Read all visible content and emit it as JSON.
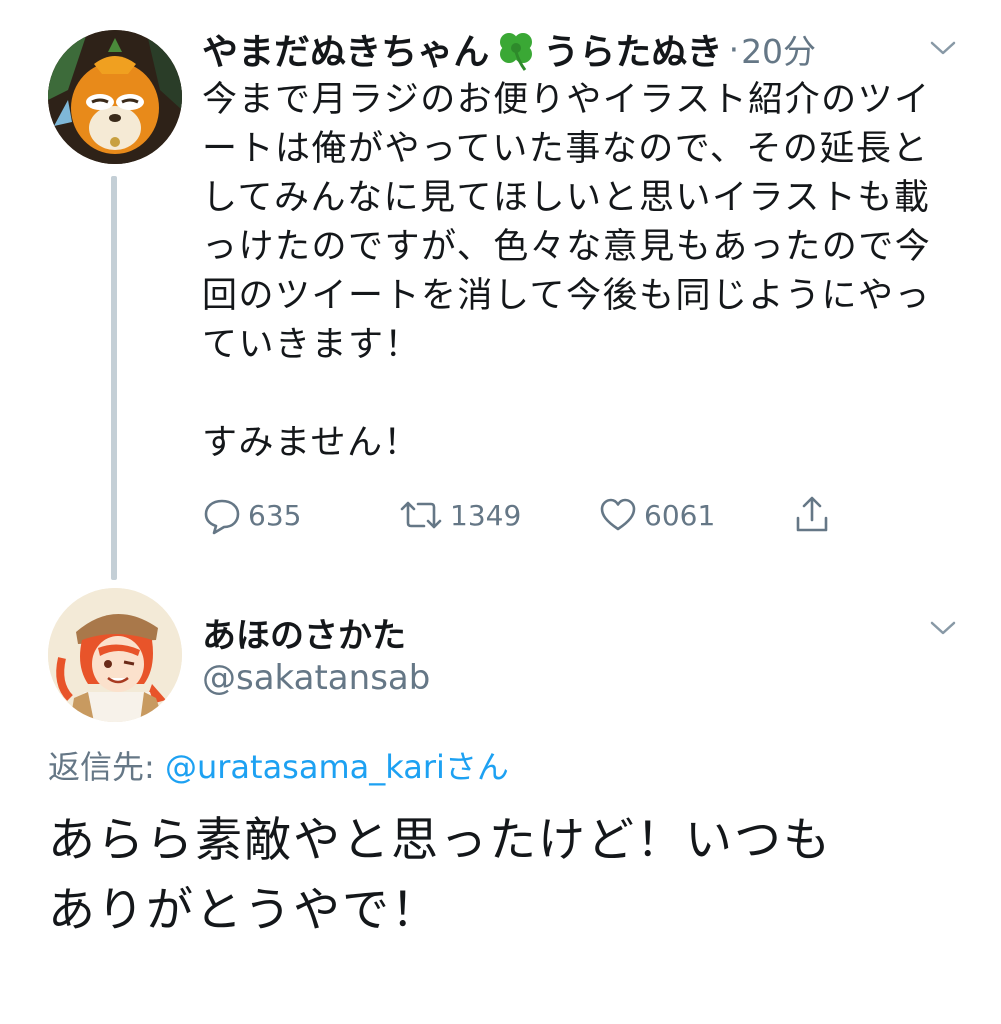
{
  "tweet1": {
    "display_name_part1": "やまだぬきちゃん",
    "display_name_part2": "うらたぬき",
    "time_separator": "·",
    "time": "20分",
    "text_lines": [
      "今まで月ラジのお便りやイラスト紹介のツイ",
      "ートは俺がやっていた事なので、その延長と",
      "してみんなに見てほしいと思いイラストも載",
      "っけたのですが、色々な意見もあったので今",
      "回のツイートを消して今後も同じようにやっ",
      "ていきます！",
      "",
      "すみません！"
    ],
    "reply_count": "635",
    "retweet_count": "1349",
    "like_count": "6061"
  },
  "tweet2": {
    "display_name": "あほのさかた",
    "handle": "@sakatansab",
    "reply_label": "返信先: ",
    "reply_mention": "@uratasama_kari",
    "reply_suffix": "さん",
    "text_lines": [
      "あらら素敵やと思ったけど！いつも",
      "ありがとうやで！"
    ]
  },
  "icons": {
    "chevron": "chevron-down-icon",
    "reply": "reply-icon",
    "retweet": "retweet-icon",
    "like": "heart-icon",
    "share": "share-icon",
    "clover": "four-leaf-clover-emoji"
  },
  "colors": {
    "text": "#14171a",
    "secondary": "#657786",
    "link": "#1da1f2",
    "thread_line": "#c4cfd6",
    "clover_green": "#3aa835"
  }
}
